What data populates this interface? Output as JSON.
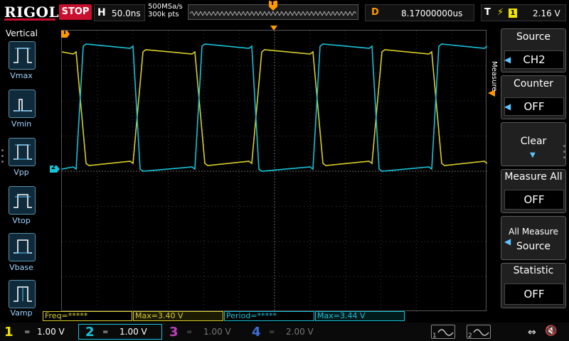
{
  "top": {
    "logo": "RIGOL",
    "run_state": "STOP",
    "h_label": "H",
    "timebase": "50.0ns",
    "sample_rate": "500MSa/s",
    "mem_depth": "300k pts",
    "trig_pos_marker": "T",
    "delay_label": "D",
    "delay_value": "8.17000000us",
    "trig_label": "T",
    "trig_edge": "rising-edge-icon",
    "trig_source": "1",
    "trig_level": "2.16 V"
  },
  "left": {
    "title": "Vertical",
    "items": [
      {
        "label": "Vmax"
      },
      {
        "label": "Vmin"
      },
      {
        "label": "Vpp"
      },
      {
        "label": "Vtop"
      },
      {
        "label": "Vbase"
      },
      {
        "label": "Vamp"
      }
    ]
  },
  "right": {
    "menu_title": "Measure",
    "source_label": "Source",
    "source_value": "CH2",
    "counter_label": "Counter",
    "counter_value": "OFF",
    "clear_label": "Clear",
    "measure_all_label": "Measure All",
    "measure_all_value": "OFF",
    "all_measure_label": "All Measure",
    "all_measure_value": "Source",
    "statistic_label": "Statistic",
    "statistic_value": "OFF"
  },
  "measurements": [
    {
      "text": "Freq=*****",
      "color": "#d9cf2a"
    },
    {
      "text": "Max=3.40 V",
      "color": "#d9cf2a"
    },
    {
      "text": "Period=*****",
      "color": "#17c3d9"
    },
    {
      "text": "Max=3.44 V",
      "color": "#17c3d9"
    }
  ],
  "channels": [
    {
      "num": "1",
      "coupling": "=",
      "scale": "1.00 V",
      "color": "#f2e600"
    },
    {
      "num": "2",
      "coupling": "=",
      "scale": "1.00 V",
      "color": "#17c3d9"
    },
    {
      "num": "3",
      "coupling": "=",
      "scale": "1.00 V",
      "color": "#c040c0"
    },
    {
      "num": "4",
      "coupling": "=",
      "scale": "2.00 V",
      "color": "#3a6fd8"
    }
  ],
  "markers": {
    "ch1": "T",
    "ch2": "2"
  },
  "colors": {
    "ch1": "#d9cf2a",
    "ch2": "#17c3d9",
    "trigger": "#f90",
    "grid": "#3a3a3a"
  }
}
